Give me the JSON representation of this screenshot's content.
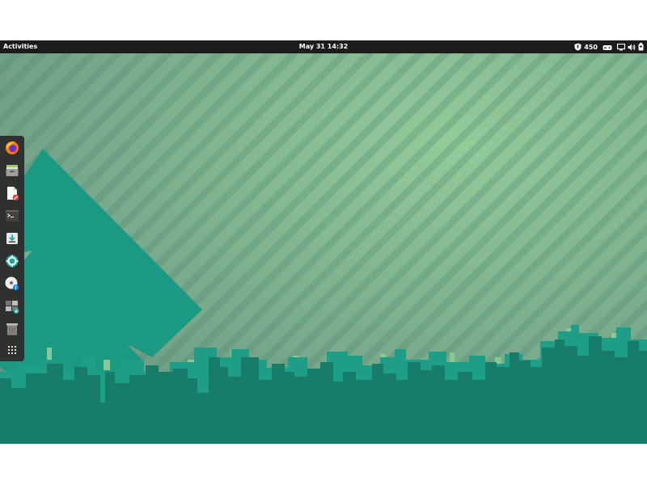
{
  "topbar": {
    "activities_label": "Activities",
    "clock_text": "May 31  14:32",
    "tray": {
      "shield_icon": "shield-icon",
      "counter_text": "450",
      "indicator_icon": "gamepad-icon",
      "network_icon": "network-icon",
      "volume_icon": "volume-icon",
      "battery_icon": "battery-icon"
    }
  },
  "dock": {
    "items": [
      {
        "name": "firefox",
        "icon": "firefox-icon"
      },
      {
        "name": "files",
        "icon": "files-icon"
      },
      {
        "name": "text-editor",
        "icon": "text-editor-icon"
      },
      {
        "name": "terminal",
        "icon": "terminal-icon"
      },
      {
        "name": "installer",
        "icon": "download-icon"
      },
      {
        "name": "software-updater",
        "icon": "lifebuoy-icon"
      },
      {
        "name": "disc-burner",
        "icon": "disc-icon"
      },
      {
        "name": "system-monitor",
        "icon": "monitor-icon"
      },
      {
        "name": "trash",
        "icon": "trash-icon"
      },
      {
        "name": "show-applications",
        "icon": "grid-icon"
      }
    ]
  },
  "colors": {
    "topbar_bg": "#1b1d1d",
    "dock_bg": "#2e3130",
    "wallpaper_bg": "#7fb38f",
    "stripe": "#6e9f82",
    "diamond": "#1a9a83",
    "skyline_front": "#177d69",
    "skyline_back": "#1e9e86",
    "skyline_highlight": "#86c998"
  }
}
